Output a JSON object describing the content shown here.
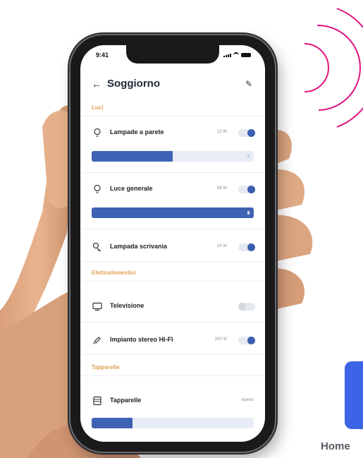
{
  "status_bar": {
    "time": "9:41"
  },
  "header": {
    "back_icon": "arrow-left-icon",
    "title": "Soggiorno",
    "edit_icon": "pencil-icon"
  },
  "sections": {
    "lights": "Luci",
    "appliances": "Elettrodomestici",
    "shutters": "Tapparelle"
  },
  "devices": {
    "wall_lamps": {
      "label": "Lampade a parete",
      "power": "12 W",
      "on": true,
      "level": 0.5
    },
    "main_light": {
      "label": "Luce generale",
      "power": "58 W",
      "on": true,
      "level": 1.0
    },
    "desk_lamp": {
      "label": "Lampada scrivania",
      "power": "20 W",
      "on": true
    },
    "tv": {
      "label": "Televisione",
      "on": false
    },
    "stereo": {
      "label": "Impianto stereo HI-FI",
      "power": "200 W",
      "on": true
    },
    "shutters": {
      "label": "Tapparelle",
      "status": "Aperte",
      "level": 0.25
    }
  },
  "brand": {
    "text": "Home",
    "color": "#3d63e6"
  },
  "colors": {
    "accent": "#3f63b4",
    "section": "#e0a052",
    "waves": "#e0137f"
  }
}
